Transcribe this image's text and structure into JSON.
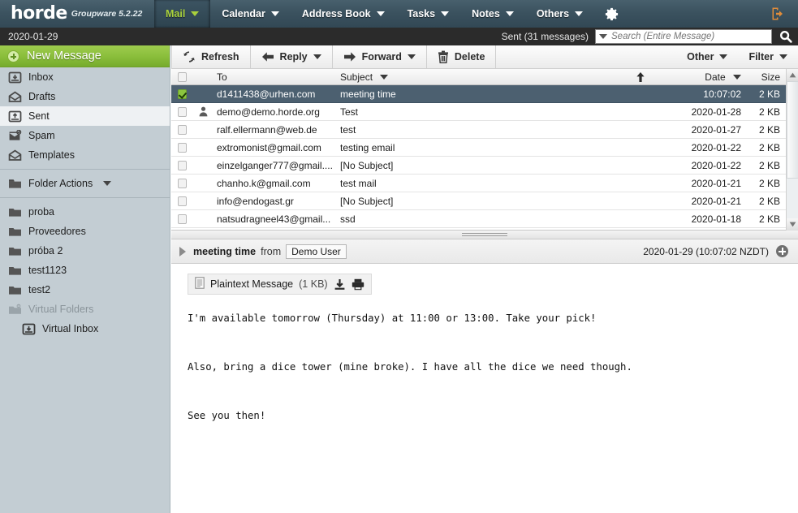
{
  "header": {
    "logo": "horde",
    "logo_sub": "Groupware 5.2.22",
    "nav": [
      {
        "label": "Mail",
        "active": true
      },
      {
        "label": "Calendar",
        "active": false
      },
      {
        "label": "Address Book",
        "active": false
      },
      {
        "label": "Tasks",
        "active": false
      },
      {
        "label": "Notes",
        "active": false
      },
      {
        "label": "Others",
        "active": false
      }
    ],
    "gear_icon": "gear-icon",
    "logout_icon": "logout-icon"
  },
  "subbar": {
    "date": "2020-01-29",
    "mailbox_status": "Sent (31 messages)",
    "search_placeholder": "Search (Entire Message)",
    "search_value": "",
    "search_icon": "search-icon",
    "dropdown_icon": "chevron-down-icon"
  },
  "sidebar": {
    "new_message": "New Message",
    "folders": [
      {
        "label": "Inbox",
        "icon": "inbox-icon",
        "selected": false
      },
      {
        "label": "Drafts",
        "icon": "envelope-open-icon",
        "selected": false
      },
      {
        "label": "Sent",
        "icon": "sent-icon",
        "selected": true
      },
      {
        "label": "Spam",
        "icon": "spam-icon",
        "selected": false
      },
      {
        "label": "Templates",
        "icon": "envelope-open-icon",
        "selected": false
      }
    ],
    "folder_actions": "Folder Actions",
    "user_folders": [
      {
        "label": "proba",
        "icon": "folder-icon",
        "muted": false,
        "indent": false
      },
      {
        "label": "Proveedores",
        "icon": "folder-icon",
        "muted": false,
        "indent": false
      },
      {
        "label": "próba 2",
        "icon": "folder-icon",
        "muted": false,
        "indent": false
      },
      {
        "label": "test1123",
        "icon": "folder-icon",
        "muted": false,
        "indent": false
      },
      {
        "label": "test2",
        "icon": "folder-icon",
        "muted": false,
        "indent": false
      },
      {
        "label": "Virtual Folders",
        "icon": "folder-minus-icon",
        "muted": true,
        "indent": false
      },
      {
        "label": "Virtual Inbox",
        "icon": "inbox-icon",
        "muted": false,
        "indent": true
      }
    ]
  },
  "toolbar": {
    "refresh": "Refresh",
    "reply": "Reply",
    "forward": "Forward",
    "delete": "Delete",
    "other": "Other",
    "filter": "Filter"
  },
  "list": {
    "columns": {
      "to": "To",
      "subject": "Subject",
      "date": "Date",
      "size": "Size"
    },
    "sort_indicator": "sort-asc-icon",
    "rows": [
      {
        "to": "d1411438@urhen.com",
        "subject": "meeting time",
        "date": "10:07:02",
        "size": "2 KB",
        "selected": true,
        "checked": true,
        "person": false
      },
      {
        "to": "demo@demo.horde.org",
        "subject": "Test",
        "date": "2020-01-28",
        "size": "2 KB",
        "selected": false,
        "checked": false,
        "person": true
      },
      {
        "to": "ralf.ellermann@web.de",
        "subject": "test",
        "date": "2020-01-27",
        "size": "2 KB",
        "selected": false,
        "checked": false,
        "person": false
      },
      {
        "to": "extromonist@gmail.com",
        "subject": "testing email",
        "date": "2020-01-22",
        "size": "2 KB",
        "selected": false,
        "checked": false,
        "person": false
      },
      {
        "to": "einzelganger777@gmail....",
        "subject": "[No Subject]",
        "date": "2020-01-22",
        "size": "2 KB",
        "selected": false,
        "checked": false,
        "person": false
      },
      {
        "to": "chanho.k@gmail.com",
        "subject": "test mail",
        "date": "2020-01-21",
        "size": "2 KB",
        "selected": false,
        "checked": false,
        "person": false
      },
      {
        "to": "info@endogast.gr",
        "subject": "[No Subject]",
        "date": "2020-01-21",
        "size": "2 KB",
        "selected": false,
        "checked": false,
        "person": false
      },
      {
        "to": "natsudragneel43@gmail...",
        "subject": "ssd",
        "date": "2020-01-18",
        "size": "2 KB",
        "selected": false,
        "checked": false,
        "person": false
      }
    ]
  },
  "message": {
    "subject": "meeting time",
    "from_word": "from",
    "from_name": "Demo User",
    "date": "2020-01-29 (10:07:02 NZDT)",
    "expand_icon": "triangle-right-icon",
    "more_icon": "plus-circle-icon",
    "attachment_label": "Plaintext Message",
    "attachment_size": "(1 KB)",
    "attachment_icon": "document-icon",
    "download_icon": "download-icon",
    "print_icon": "print-icon",
    "body": "I'm available tomorrow (Thursday) at 11:00 or 13:00. Take your pick!\n\nAlso, bring a dice tower (mine broke). I have all the dice we need though.\n\nSee you then!"
  },
  "colors": {
    "header_bg": "#3b525f",
    "accent_green": "#8cc63f",
    "selected_row": "#4c6070",
    "sidebar_bg": "#c3cdd3",
    "logout_orange": "#e08c3a"
  }
}
